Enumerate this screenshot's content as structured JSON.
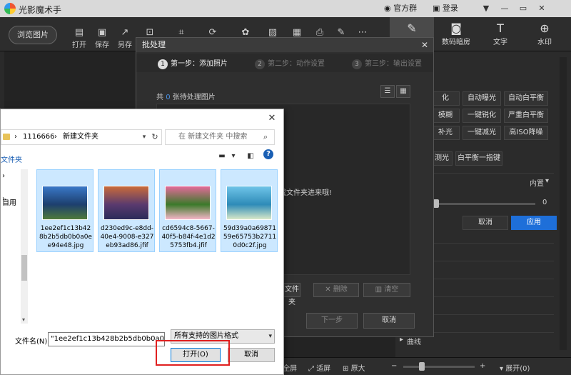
{
  "app": {
    "title": "光影魔术手",
    "official_group": "官方群",
    "login": "登录",
    "window_controls": [
      "▼",
      "—",
      "✕"
    ]
  },
  "toolbar": {
    "browse": "浏览图片",
    "tools": [
      "打开",
      "保存",
      "另存"
    ],
    "right_tabs": [
      "",
      "数码暗房",
      "文字",
      "水印"
    ]
  },
  "right_panel": {
    "buttons": [
      "化",
      "自动曝光",
      "自动白平衡",
      "模糊",
      "一键锐化",
      "严重白平衡",
      "补光",
      "一键减光",
      "高ISO降噪",
      "测光",
      "白平衡一指键"
    ],
    "section_label": "内置",
    "slider_value": "0",
    "cancel": "取消",
    "apply": "应用",
    "bottom_item": "曲线"
  },
  "statusbar": {
    "items": [
      "全屏",
      "适屏",
      "原大",
      "展开(0)"
    ]
  },
  "batch": {
    "title": "批处理",
    "close": "✕",
    "steps": [
      {
        "num": "1",
        "label": "第一步：添加照片"
      },
      {
        "num": "2",
        "label": "第二步：动作设置"
      },
      {
        "num": "3",
        "label": "第三步：输出设置"
      }
    ],
    "count_prefix": "共",
    "count_value": "0",
    "count_suffix": "张待处理图片",
    "drop_hint": "地图片或文件夹进来哦!",
    "actions": [
      "文件夹",
      "删除",
      "清空"
    ],
    "next": "下一步",
    "cancel": "取消"
  },
  "file_dialog": {
    "close": "✕",
    "path": [
      "1116666",
      "新建文件夹"
    ],
    "search_placeholder": "在 新建文件夹 中搜索",
    "new_folder": "文件夹",
    "help": "?",
    "nav_items": [
      "自用"
    ],
    "files": [
      {
        "name": "1ee2ef1c13b428b2b5db0b0a0ee94e48.jpg",
        "colors": [
          "#3a78c8",
          "#1d3f6e",
          "#4f7a3a"
        ]
      },
      {
        "name": "d230ed9c-e8dd-40e4-9008-e327eb93ad86.jfif",
        "colors": [
          "#c96b3a",
          "#5a3a6e",
          "#2b2b5a"
        ]
      },
      {
        "name": "cd6594c8-5667-40f5-b84f-4e1d25753fb4.jfif",
        "colors": [
          "#e36a9a",
          "#3b7a2a",
          "#f5b5c8"
        ]
      },
      {
        "name": "59d39a0a6987159e65753b27110d0c2f.jpg",
        "colors": [
          "#6fc4e8",
          "#2e8bb8",
          "#d8e8c8"
        ]
      }
    ],
    "filename_label": "文件名(N):",
    "filename_value": "\"1ee2ef1c13b428b2b5db0b0a0e",
    "filetype": "所有支持的图片格式",
    "open": "打开(O)",
    "cancel": "取消"
  }
}
